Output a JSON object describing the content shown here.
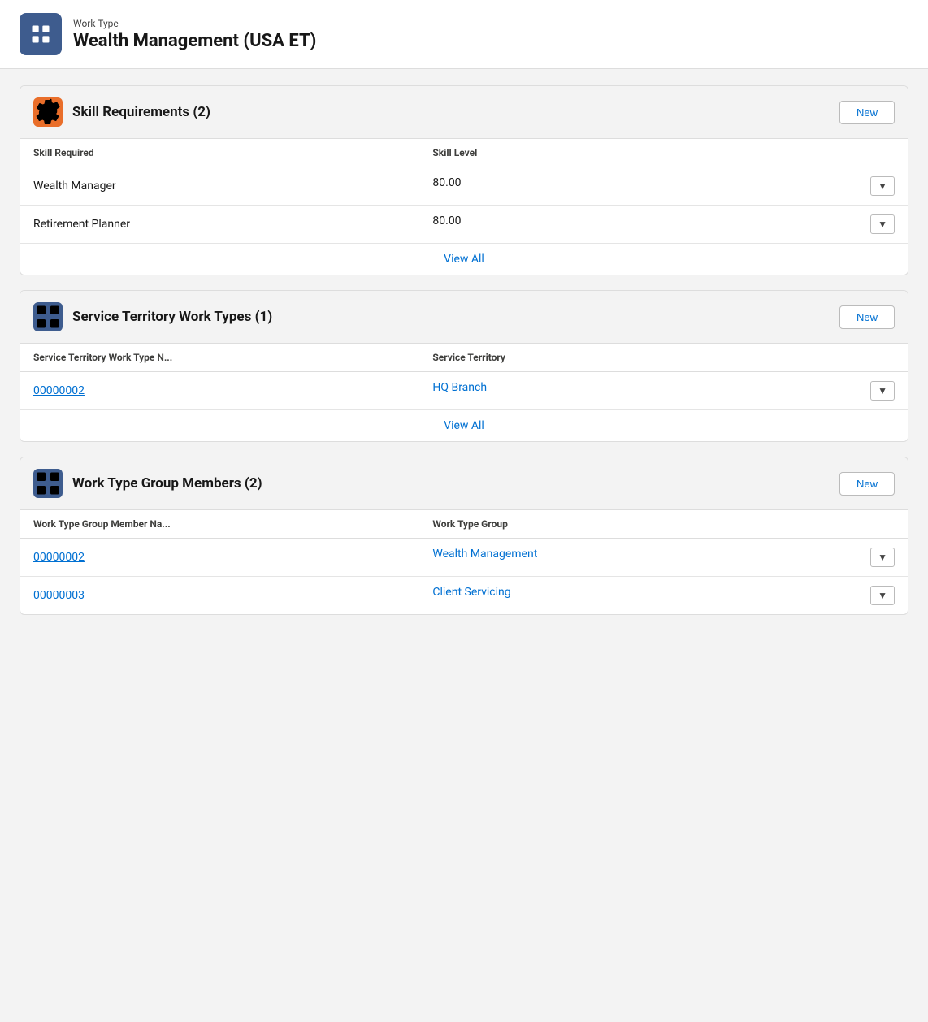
{
  "header": {
    "subtitle": "Work Type",
    "title": "Wealth Management (USA ET)"
  },
  "skillRequirements": {
    "sectionTitle": "Skill Requirements (2)",
    "newButtonLabel": "New",
    "columns": [
      "Skill Required",
      "Skill Level"
    ],
    "rows": [
      {
        "skillRequired": "Wealth Manager",
        "skillLevel": "80.00"
      },
      {
        "skillRequired": "Retirement Planner",
        "skillLevel": "80.00"
      }
    ],
    "viewAllLabel": "View All"
  },
  "serviceTerritoryWorkTypes": {
    "sectionTitle": "Service Territory Work Types (1)",
    "newButtonLabel": "New",
    "columns": [
      "Service Territory Work Type N...",
      "Service Territory"
    ],
    "rows": [
      {
        "name": "00000002",
        "serviceTerritory": "HQ Branch"
      }
    ],
    "viewAllLabel": "View All"
  },
  "workTypeGroupMembers": {
    "sectionTitle": "Work Type Group Members (2)",
    "newButtonLabel": "New",
    "columns": [
      "Work Type Group Member Na...",
      "Work Type Group"
    ],
    "rows": [
      {
        "name": "00000002",
        "workTypeGroup": "Wealth Management"
      },
      {
        "name": "00000003",
        "workTypeGroup": "Client Servicing"
      }
    ]
  }
}
